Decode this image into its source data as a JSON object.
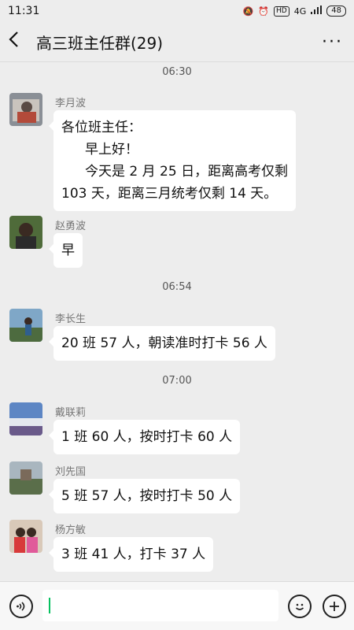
{
  "status": {
    "time": "11:31",
    "network": "4G",
    "hd": "HD",
    "battery": "48"
  },
  "header": {
    "title": "高三班主任群(29)",
    "back_icon": "chevron-left-icon",
    "more_icon": "more-icon",
    "more_glyph": "···"
  },
  "timestamps": [
    "06:30",
    "06:54",
    "07:00"
  ],
  "messages": [
    {
      "sender": "李月波",
      "lines": [
        "各位班主任：",
        "早上好！",
        "今天是 2 月 25 日，距离高考仅剩",
        "103 天，距离三月统考仅剩 14 天。"
      ]
    },
    {
      "sender": "赵勇波",
      "text": "早"
    },
    {
      "sender": "李长生",
      "text": "20 班 57 人，朝读准时打卡 56 人"
    },
    {
      "sender": "戴联莉",
      "text": "1 班 60 人，按时打卡 60 人"
    },
    {
      "sender": "刘先国",
      "text": "5 班 57 人，按时打卡 50 人"
    },
    {
      "sender": "杨方敏",
      "text": "3 班 41 人，打卡 37 人"
    }
  ],
  "input": {
    "value": ""
  }
}
